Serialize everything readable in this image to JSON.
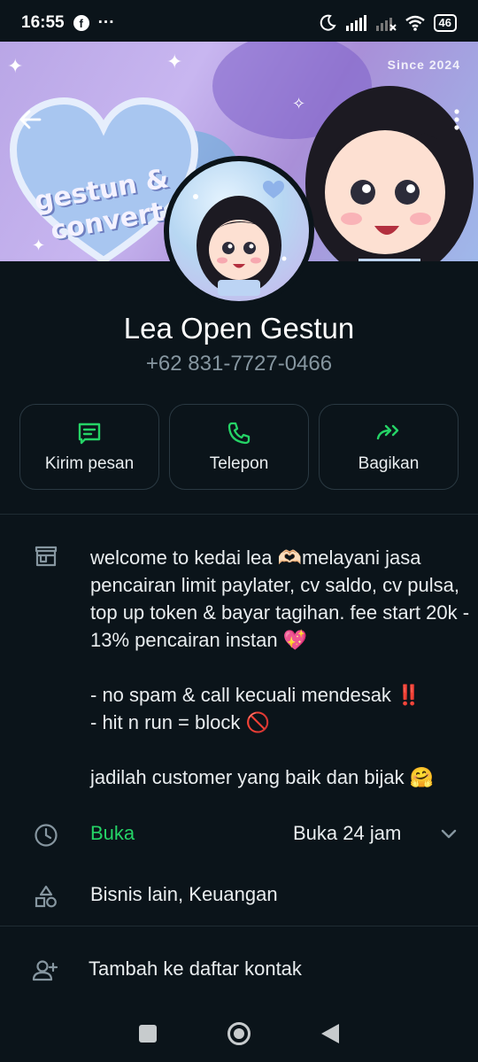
{
  "status_bar": {
    "time": "16:55",
    "notification_icons": [
      "facebook-icon",
      "more-icon"
    ],
    "more_text": "···",
    "fb_letter": "f",
    "right_icons": [
      "moon-icon",
      "signal-icon",
      "signal-off-icon",
      "wifi-icon",
      "battery-icon"
    ],
    "battery": "46"
  },
  "cover": {
    "heart_text": "gestun & convert",
    "since_text": "Since 2024"
  },
  "profile": {
    "name": "Lea Open Gestun",
    "phone": "+62 831-7727-0466"
  },
  "actions": [
    {
      "label": "Kirim pesan",
      "icon": "message-icon"
    },
    {
      "label": "Telepon",
      "icon": "phone-icon"
    },
    {
      "label": "Bagikan",
      "icon": "forward-icon"
    }
  ],
  "business": {
    "about": "welcome to kedai lea 🫶🏻melayani jasa pencairan limit paylater, cv saldo, cv pulsa, top up token & bayar tagihan. fee start 20k - 13% pencairan instan 💖\n\n- no spam & call kecuali mendesak ‼️\n- hit n run = block 🚫\n\njadilah customer yang baik dan bijak 🤗",
    "hours_status": "Buka",
    "hours_value": "Buka 24 jam",
    "category": "Bisnis lain, Keuangan",
    "add_contact": "Tambah ke daftar kontak"
  },
  "colors": {
    "background": "#0b141a",
    "accent": "#25d366",
    "secondary_text": "#8696a0",
    "border": "#2a3942"
  }
}
